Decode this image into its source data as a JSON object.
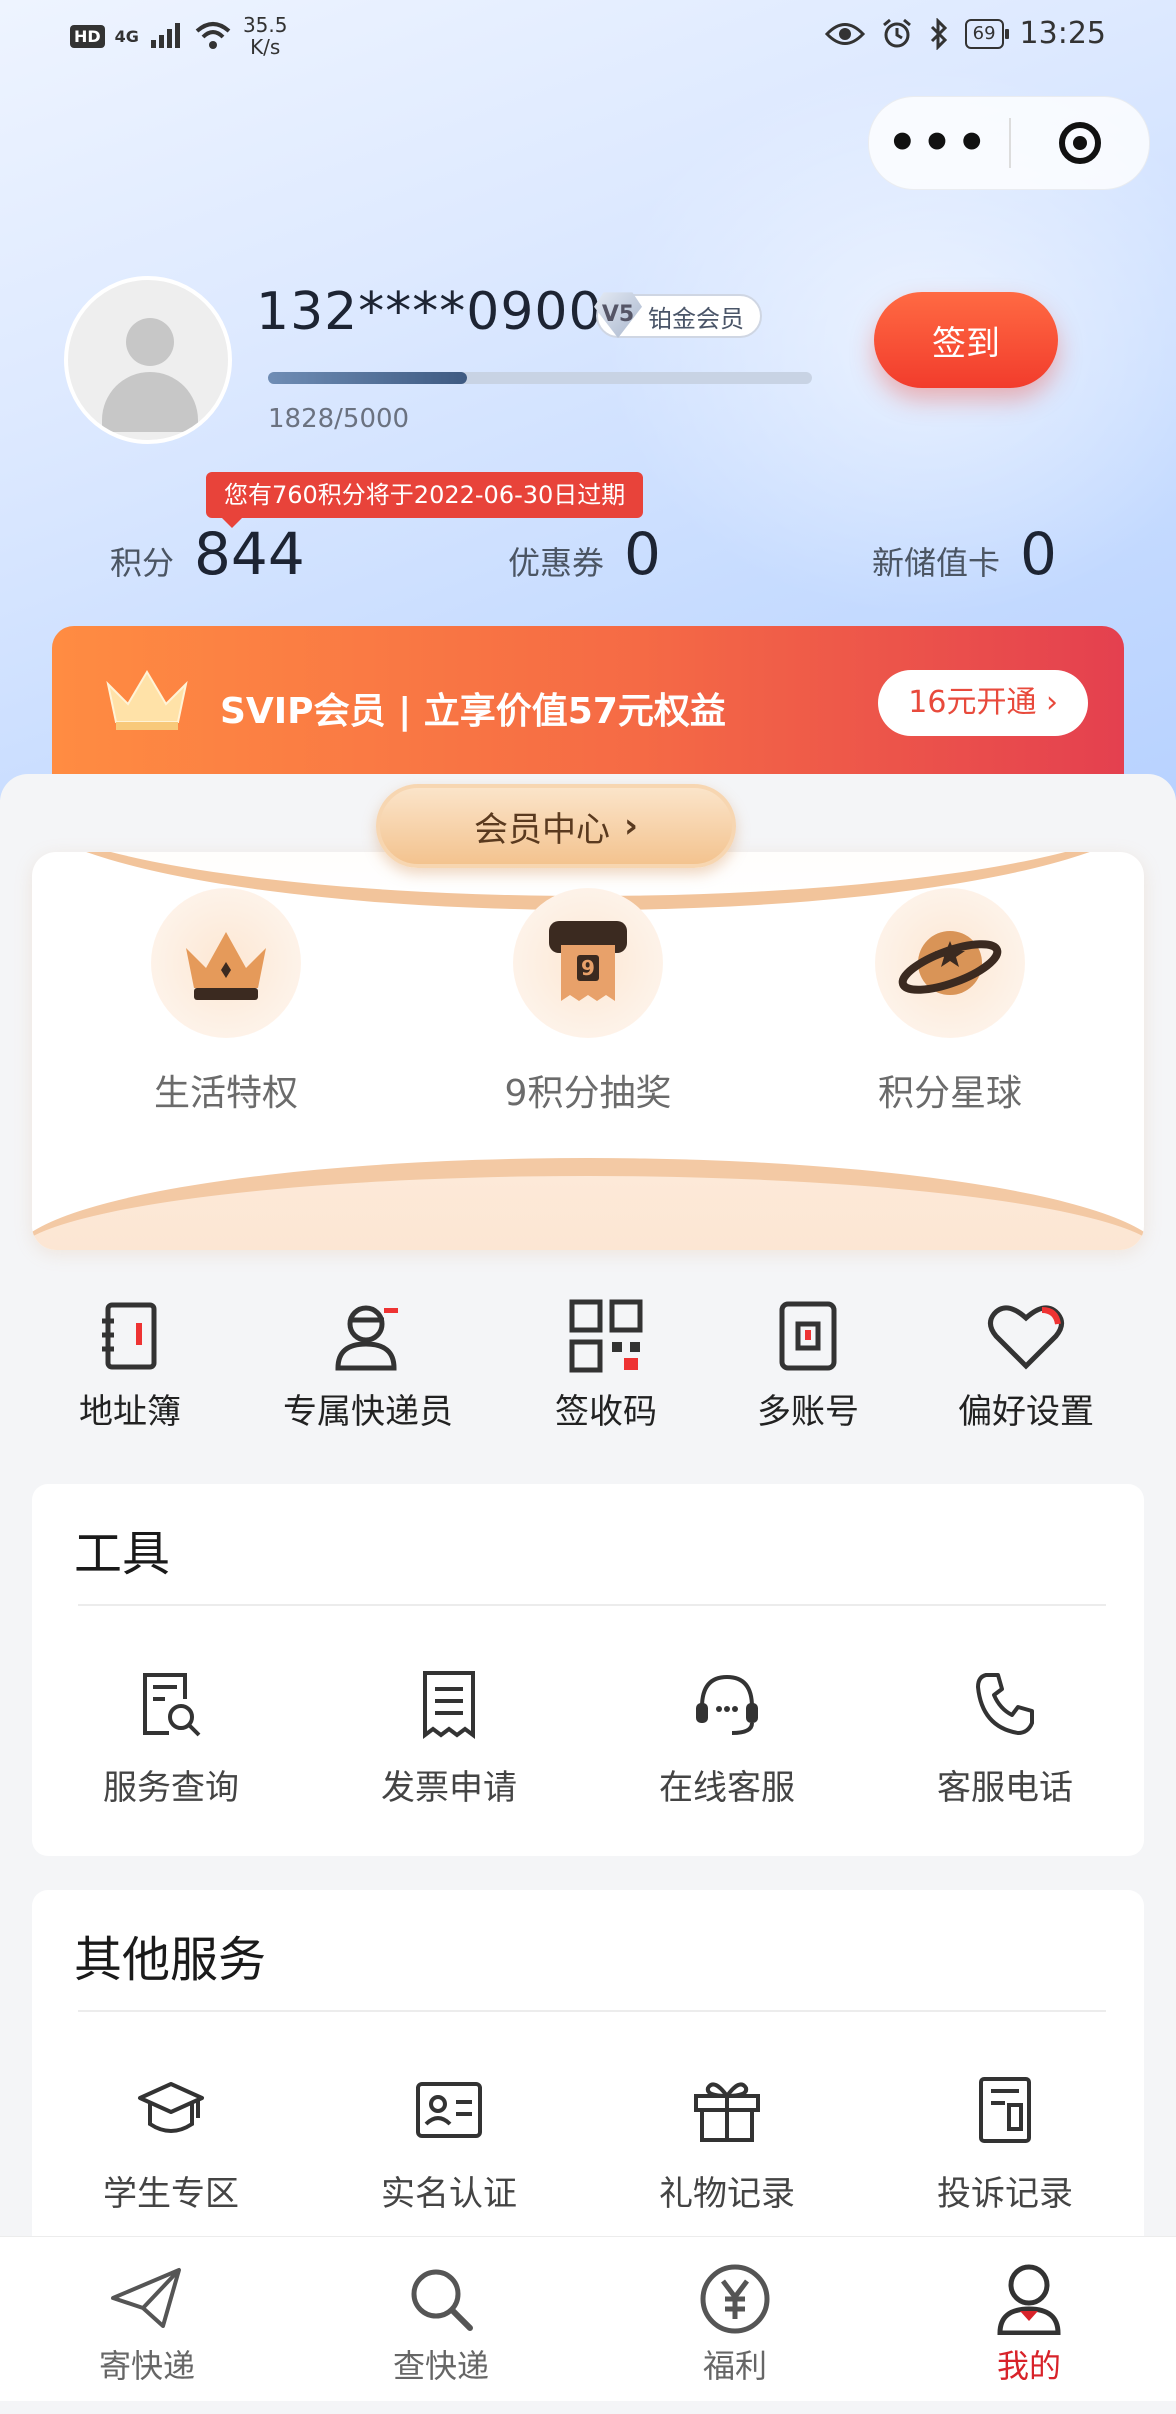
{
  "status_bar": {
    "left_badge": "HD",
    "signal": "4G",
    "speed_value": "35.5",
    "speed_unit": "K/s",
    "battery": "69",
    "time": "13:25"
  },
  "capsule": {
    "more_icon": "more-dots-icon",
    "close_icon": "target-circle-icon"
  },
  "profile": {
    "phone": "132****0900",
    "level_badge": "V5",
    "member_tier": "铂金会员",
    "progress_text": "1828/5000",
    "progress_fraction": 0.3656,
    "signin_label": "签到",
    "expiry_notice": "您有760积分将于2022-06-30日过期"
  },
  "stats": [
    {
      "label": "积分",
      "value": "844"
    },
    {
      "label": "优惠券",
      "value": "0"
    },
    {
      "label": "新储值卡",
      "value": "0"
    }
  ],
  "svip": {
    "text": "SVIP会员 | 立享价值57元权益",
    "button": "16元开通 ›"
  },
  "member_center": {
    "title": "会员中心",
    "items": [
      {
        "label": "生活特权",
        "icon": "crown-icon"
      },
      {
        "label": "9积分抽奖",
        "icon": "lottery-ticket-icon"
      },
      {
        "label": "积分星球",
        "icon": "planet-icon"
      }
    ]
  },
  "quick_links": [
    {
      "label": "地址簿",
      "icon": "address-book-icon"
    },
    {
      "label": "专属快递员",
      "icon": "courier-icon"
    },
    {
      "label": "签收码",
      "icon": "qr-code-icon"
    },
    {
      "label": "多账号",
      "icon": "multi-account-icon"
    },
    {
      "label": "偏好设置",
      "icon": "heart-icon"
    }
  ],
  "tools": {
    "title": "工具",
    "items": [
      {
        "label": "服务查询",
        "icon": "service-search-icon"
      },
      {
        "label": "发票申请",
        "icon": "invoice-icon"
      },
      {
        "label": "在线客服",
        "icon": "headset-icon"
      },
      {
        "label": "客服电话",
        "icon": "phone-icon"
      }
    ]
  },
  "other_services": {
    "title": "其他服务",
    "items": [
      {
        "label": "学生专区",
        "icon": "graduation-cap-icon"
      },
      {
        "label": "实名认证",
        "icon": "id-card-icon"
      },
      {
        "label": "礼物记录",
        "icon": "gift-icon"
      },
      {
        "label": "投诉记录",
        "icon": "complaint-record-icon"
      }
    ]
  },
  "tabbar": [
    {
      "label": "寄快递",
      "icon": "paper-plane-icon",
      "active": false
    },
    {
      "label": "查快递",
      "icon": "search-icon",
      "active": false
    },
    {
      "label": "福利",
      "icon": "yen-coin-icon",
      "active": false
    },
    {
      "label": "我的",
      "icon": "user-icon",
      "active": true
    }
  ],
  "colors": {
    "accent_red": "#d8232a",
    "signin_orange": "#f23c2c",
    "gold": "#f3c38f"
  }
}
